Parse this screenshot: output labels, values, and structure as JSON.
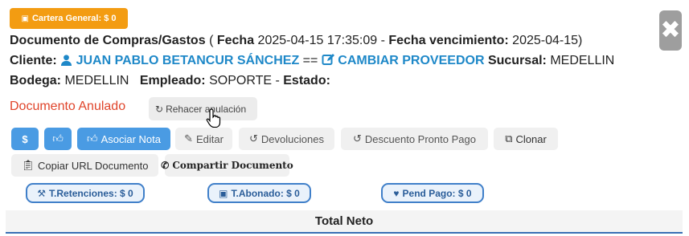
{
  "cartera": {
    "label": "Cartera General: $ 0"
  },
  "header": {
    "doc_type": "Documento de Compras/Gastos",
    "fecha_label": "Fecha",
    "fecha_value": "2025-04-15 17:35:09",
    "venc_label": "Fecha vencimiento:",
    "venc_value": "2025-04-15",
    "cliente_label": "Cliente:",
    "cliente_value": "JUAN PABLO BETANCUR SÁNCHEZ",
    "separator": "==",
    "cambiar_label": "CAMBIAR PROVEEDOR",
    "sucursal_label": "Sucursal:",
    "sucursal_value": "MEDELLIN",
    "bodega_label": "Bodega:",
    "bodega_value": "MEDELLIN",
    "empleado_label": "Empleado:",
    "empleado_value": "SOPORTE",
    "estado_label": "Estado:"
  },
  "status": {
    "anulado": "Documento Anulado",
    "rehacer": "Rehacer anulación"
  },
  "actions": {
    "dollar": "$",
    "asociar_nota": "Asociar Nota",
    "editar": "Editar",
    "devoluciones": "Devoluciones",
    "descuento": "Descuento Pronto Pago",
    "clonar": "Clonar",
    "copiar_url": "Copiar URL Documento",
    "compartir": "Compartir Documento"
  },
  "totals": {
    "retenciones": "T.Retenciones: $ 0",
    "abonado": "T.Abonado: $ 0",
    "pend_pago": "Pend Pago: $ 0",
    "total_neto": "Total Neto"
  },
  "colors": {
    "cartera_badge": "#f39c12",
    "link": "#1e88c8",
    "anulado": "#e0452b",
    "primary_button": "#4a9be3",
    "pill_border": "#3f7fc9"
  }
}
